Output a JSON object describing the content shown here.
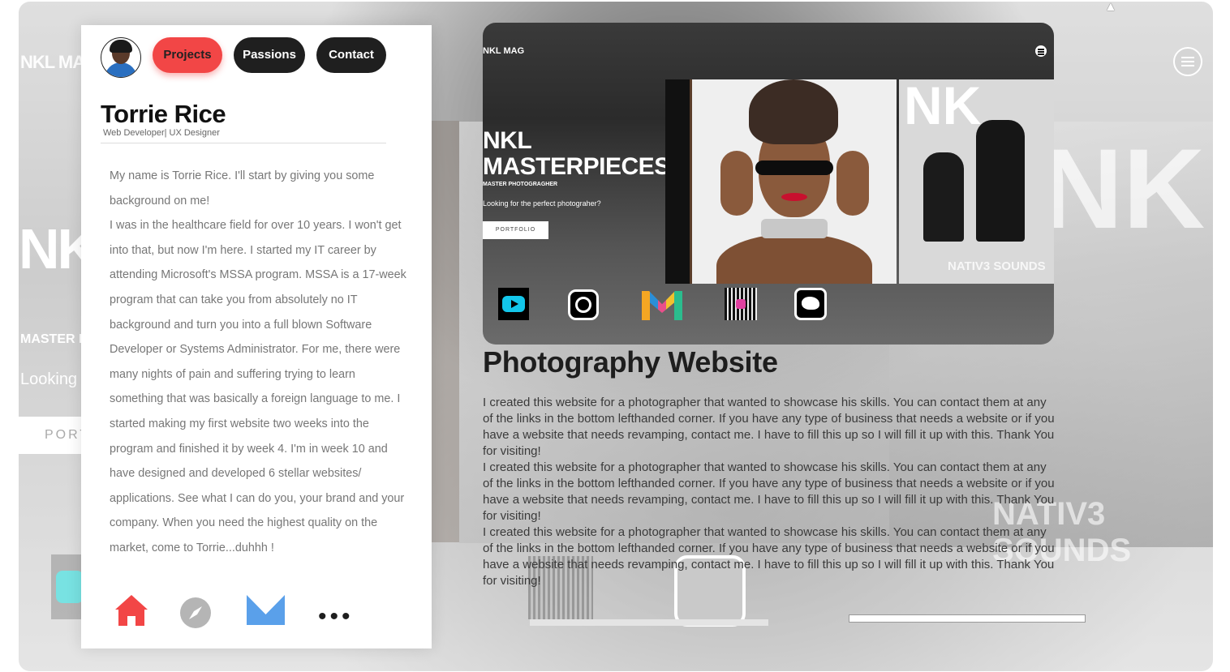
{
  "profile": {
    "name": "Torrie Rice",
    "role": "Web Developer| UX Designer",
    "bio": [
      "My name is Torrie Rice. I'll start by giving you some background on me!",
      "I was in the healthcare field for over 10 years. I won't get into that, but now I'm here. I started my IT career by attending Microsoft's MSSA program. MSSA is a 17-week program that can take you from absolutely no IT background and turn you into a full blown Software Developer or Systems Administrator. For me, there were many nights of pain and suffering trying to learn something that was basically a foreign language to me. I started making my first website two weeks into the program and finished it by week 4. I'm in week 10 and have designed and developed 6 stellar websites/ applications. See what I can do you, your brand and your company. When you need the highest quality on the market, come to Torrie...duhhh !"
    ]
  },
  "tabs": {
    "projects": "Projects",
    "passions": "Passions",
    "contact": "Contact"
  },
  "bottom_nav": {
    "more": "•••"
  },
  "preview": {
    "brand": "NKL MAG",
    "hero_title": "NKL MASTERPIECES",
    "hero_sub": "MASTER PHOTOGRAGHER",
    "hero_text": "Looking for the perfect photograher?",
    "hero_button": "PORTFOLIO",
    "cover_logo": "NK",
    "cover_caption": "NATIV3 SOUNDS"
  },
  "background": {
    "brand": "NKL MA",
    "hero": "NK MA",
    "sub": "MASTER P",
    "looking": "Looking",
    "button": "PORT",
    "cover_logo": "NK",
    "cover_caption": "NATIV3 SOUNDS"
  },
  "project": {
    "title": "Photography Website",
    "paragraphs": [
      "I created this website for a photographer that wanted to showcase his skills. You can contact them at any of the links in the bottom lefthanded corner. If you have any type of business that needs a website or if you have a website that needs revamping, contact me.  I have to fill this up so I will fill it up with this. Thank You for visiting!",
      "I created this website for a photographer that wanted to showcase his skills. You can contact them at any of the links in the bottom lefthanded corner. If you have any type of business that needs a website or if you have a website that needs revamping, contact me.  I have to fill this up so I will fill it up with this. Thank You for visiting!",
      "I created this website for a photographer that wanted to showcase his skills. You can contact them at any of the links in the bottom lefthanded corner. If you have any type of business that needs a website or if you have a website that needs revamping, contact me.  I have to fill this up so I will fill it up with this. Thank You for visiting!"
    ]
  },
  "colors": {
    "accent": "#f24646",
    "pill_dark": "#1f1f1f",
    "mail_blue": "#5aa0ea"
  },
  "icons": [
    "home-icon",
    "compass-icon",
    "mail-icon",
    "more-icon",
    "youtube-icon",
    "instagram-icon",
    "gmail-icon",
    "qr-code-icon",
    "twitter-icon",
    "hamburger-menu-icon"
  ]
}
